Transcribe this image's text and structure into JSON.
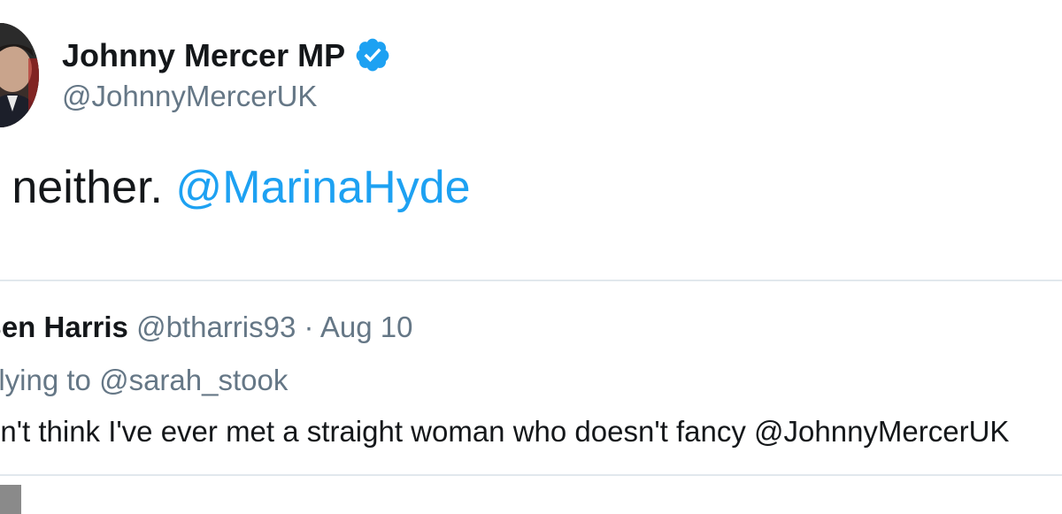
{
  "tweet": {
    "author_name": "Johnny Mercer MP",
    "author_handle": "@JohnnyMercerUK",
    "verified_icon": "verified-badge-icon",
    "text_prefix": "e neither.",
    "text_mention": "@MarinaHyde"
  },
  "quoted_tweet": {
    "name": "Ben Harris",
    "handle": "@btharris93",
    "separator": "·",
    "date": "Aug 10",
    "replying_to": "plying to @sarah_stook",
    "text": "on't think I've ever met a straight woman who doesn't fancy @JohnnyMercerUK"
  },
  "colors": {
    "link": "#1da1f2",
    "verified": "#1da1f2",
    "secondary_text": "#657786",
    "primary_text": "#14171a",
    "border": "#e1e8ed"
  }
}
